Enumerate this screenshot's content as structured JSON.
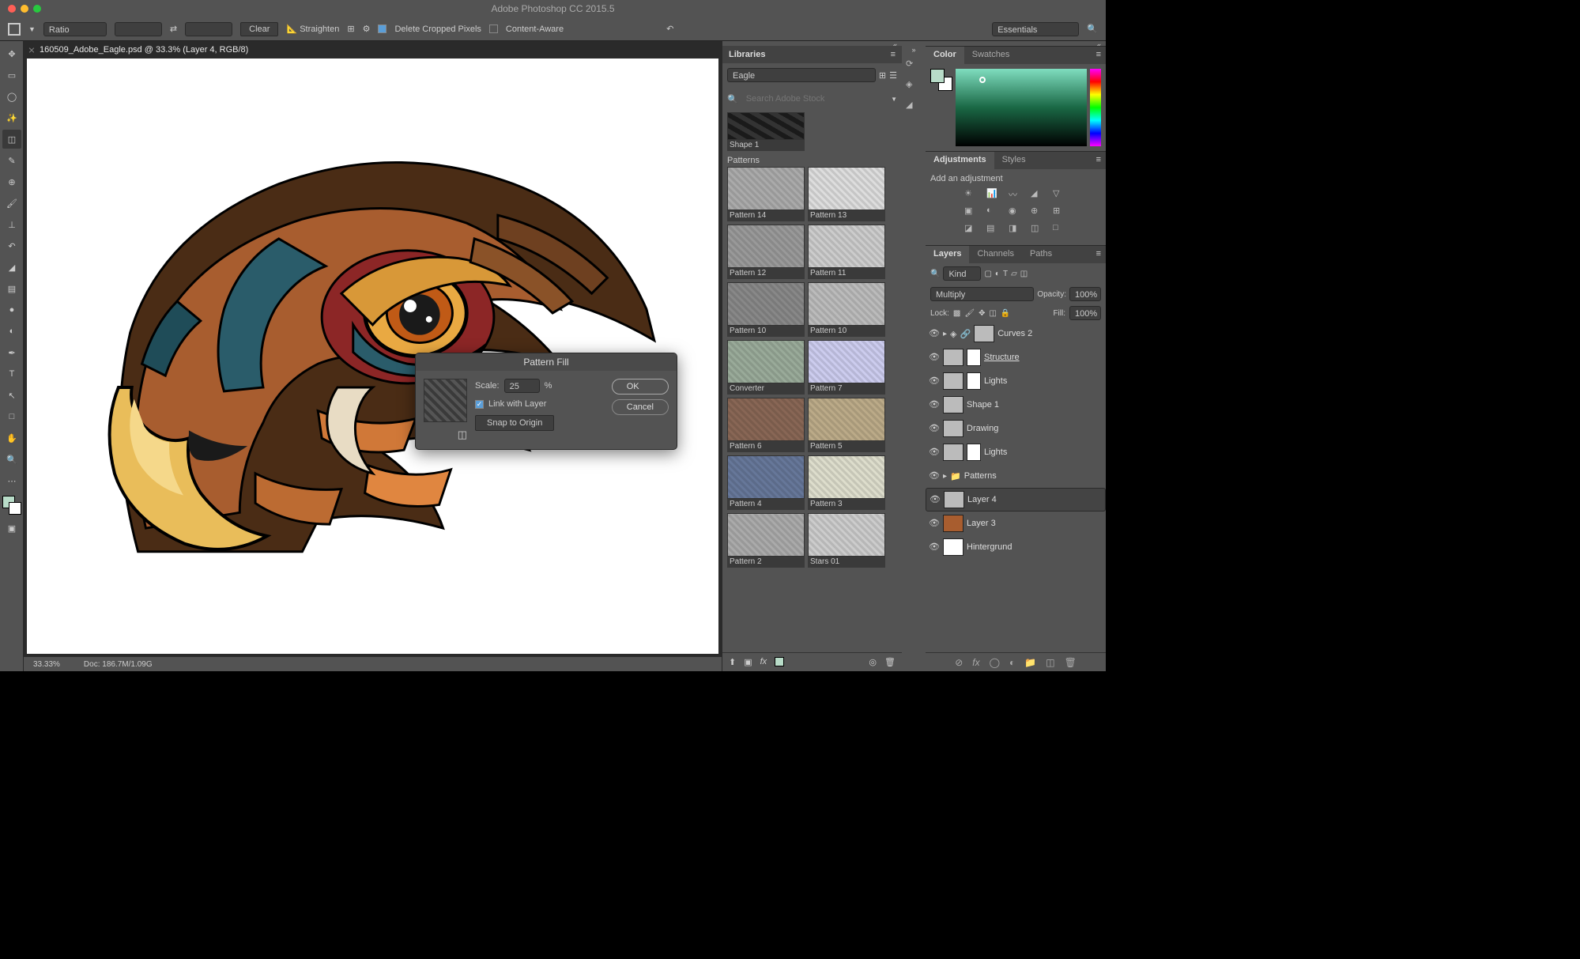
{
  "app_title": "Adobe Photoshop CC 2015.5",
  "workspace_dropdown": "Essentials",
  "options": {
    "ratio": "Ratio",
    "clear": "Clear",
    "straighten": "Straighten",
    "delete_cropped": "Delete Cropped Pixels",
    "content_aware": "Content-Aware"
  },
  "doc_tab": "160509_Adobe_Eagle.psd @ 33.3% (Layer 4, RGB/8)",
  "status": {
    "zoom": "33.33%",
    "doc": "Doc: 186.7M/1.09G"
  },
  "dialog": {
    "title": "Pattern Fill",
    "scale_label": "Scale:",
    "scale_value": "25",
    "scale_unit": "%",
    "link": "Link with Layer",
    "snap": "Snap to Origin",
    "ok": "OK",
    "cancel": "Cancel"
  },
  "libraries": {
    "title": "Libraries",
    "selected": "Eagle",
    "search_ph": "Search Adobe Stock",
    "shape": "Shape 1",
    "patterns_label": "Patterns",
    "items": [
      [
        "Pattern 14",
        "Pattern 13"
      ],
      [
        "Pattern 12",
        "Pattern 11"
      ],
      [
        "Pattern 10",
        "Pattern 10"
      ],
      [
        "Converter",
        "Pattern 7"
      ],
      [
        "Pattern 6",
        "Pattern 5"
      ],
      [
        "Pattern 4",
        "Pattern 3"
      ],
      [
        "Pattern 2",
        "Stars 01"
      ]
    ]
  },
  "color_panel": {
    "tab1": "Color",
    "tab2": "Swatches"
  },
  "adjustments": {
    "tab1": "Adjustments",
    "tab2": "Styles",
    "title": "Add an adjustment"
  },
  "layers_panel": {
    "tab1": "Layers",
    "tab2": "Channels",
    "tab3": "Paths",
    "kind": "Kind",
    "blend": "Multiply",
    "opacity_label": "Opacity:",
    "opacity": "100%",
    "lock_label": "Lock:",
    "fill_label": "Fill:",
    "fill": "100%",
    "layers": [
      {
        "name": "Curves 2"
      },
      {
        "name": "Structure"
      },
      {
        "name": "Lights"
      },
      {
        "name": "Shape 1"
      },
      {
        "name": "Drawing"
      },
      {
        "name": "Lights"
      },
      {
        "name": "Patterns"
      },
      {
        "name": "Layer 4"
      },
      {
        "name": "Layer 3"
      },
      {
        "name": "Hintergrund"
      }
    ]
  }
}
